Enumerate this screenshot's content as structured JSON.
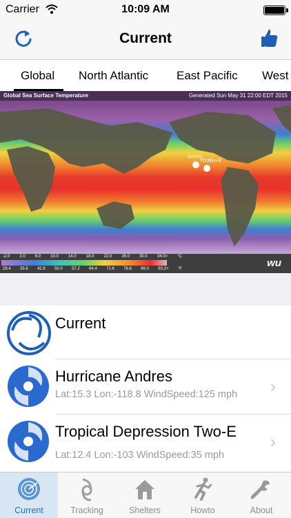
{
  "status": {
    "carrier": "Carrier",
    "time": "10:09 AM"
  },
  "nav": {
    "title": "Current"
  },
  "tabs": [
    "Global",
    "North Atlantic",
    "East Pacific",
    "West"
  ],
  "map": {
    "title": "Global Sea Surface Temperature",
    "generated": "Generated Sun May 31 22:00 EDT 2015",
    "scale_c": [
      "-2.0",
      "2.0",
      "6.0",
      "10.0",
      "14.0",
      "18.0",
      "22.0",
      "26.0",
      "30.0",
      "34.0>",
      "°C"
    ],
    "scale_f": [
      "28.4",
      "35.6",
      "42.8",
      "50.0",
      "57.2",
      "64.4",
      "71.6",
      "78.8",
      "86.0",
      "93.2>",
      "°F"
    ],
    "storm_labels": [
      "Andres",
      "TD3Ero-E"
    ],
    "brand": "wu"
  },
  "list": {
    "header": "Current",
    "storms": [
      {
        "name": "Hurricane Andres",
        "details": "Lat:15.3 Lon:-118.8 WindSpeed:125 mph"
      },
      {
        "name": "Tropical Depression Two-E",
        "details": "Lat:12.4 Lon:-103 WindSpeed:35 mph"
      }
    ]
  },
  "tabbar": [
    "Current",
    "Tracking",
    "Shelters",
    "Howto",
    "About"
  ],
  "colors": {
    "accent": "#1a6fd1",
    "hurricane_blue": "#1e5fb8"
  }
}
